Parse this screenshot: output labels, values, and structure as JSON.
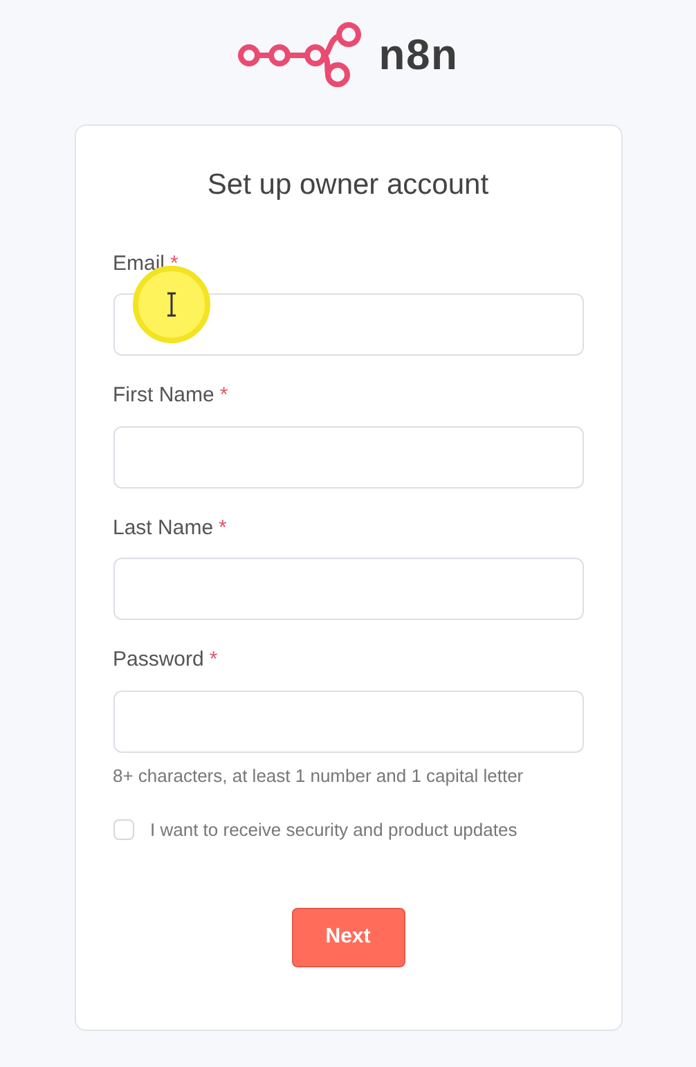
{
  "logo": {
    "text": "n8n"
  },
  "card": {
    "title": "Set up owner account",
    "fields": [
      {
        "label": "Email",
        "required_mark": "*"
      },
      {
        "label": "First Name",
        "required_mark": "*"
      },
      {
        "label": "Last Name",
        "required_mark": "*"
      },
      {
        "label": "Password",
        "required_mark": "*",
        "hint": "8+ characters, at least 1 number and 1 capital letter"
      }
    ],
    "checkbox": {
      "label": "I want to receive security and product updates",
      "checked": false
    },
    "button": {
      "label": "Next"
    }
  }
}
